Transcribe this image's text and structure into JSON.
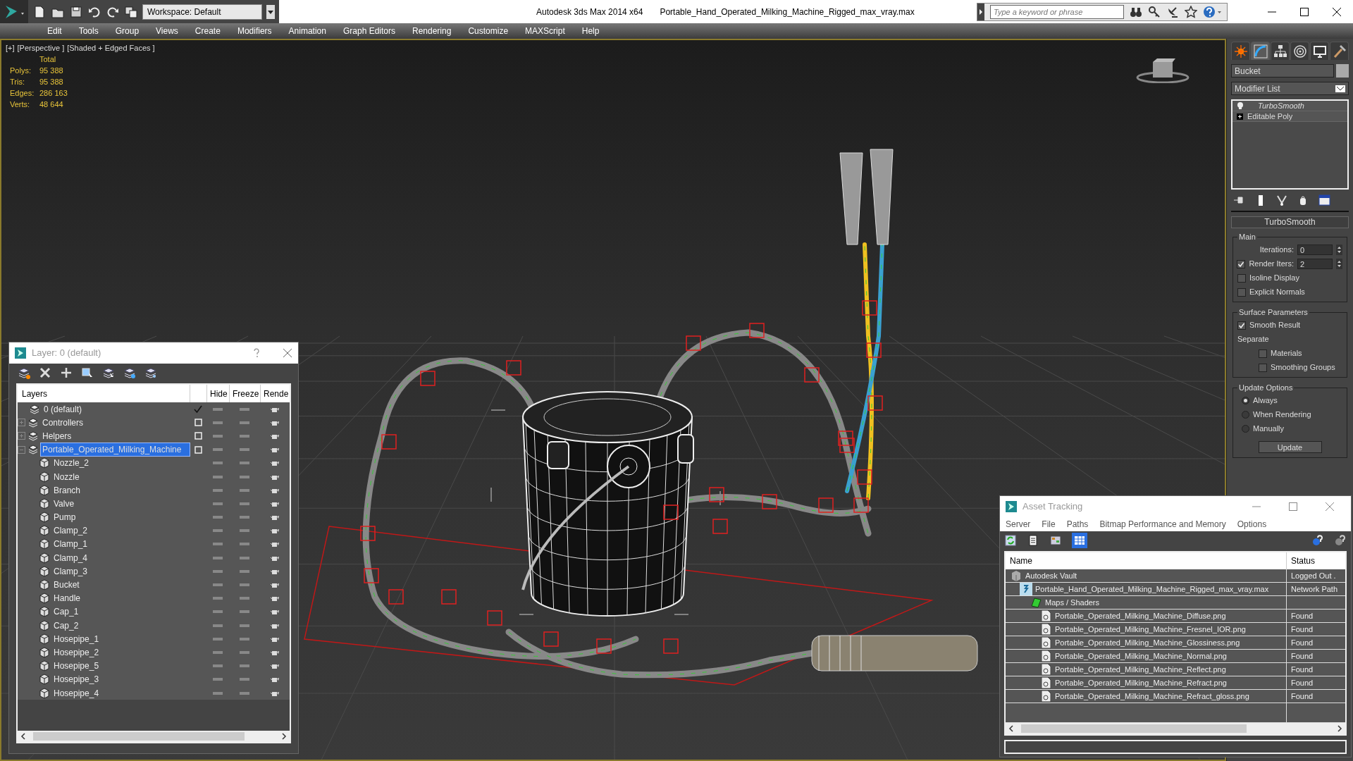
{
  "title_bar": {
    "workspace": "Workspace: Default",
    "app_title": "Autodesk 3ds Max  2014 x64",
    "file_title": "Portable_Hand_Operated_Milking_Machine_Rigged_max_vray.max",
    "search_placeholder": "Type a keyword or phrase"
  },
  "menu": [
    "Edit",
    "Tools",
    "Group",
    "Views",
    "Create",
    "Modifiers",
    "Animation",
    "Graph Editors",
    "Rendering",
    "Customize",
    "MAXScript",
    "Help"
  ],
  "viewport": {
    "labels": [
      "[+]",
      "[Perspective ]",
      "[Shaded + Edged Faces ]"
    ],
    "stats": {
      "header": "Total",
      "rows": [
        {
          "label": "Polys:",
          "value": "95 388"
        },
        {
          "label": "Tris:",
          "value": "95 388"
        },
        {
          "label": "Edges:",
          "value": "286 163"
        },
        {
          "label": "Verts:",
          "value": "48 644"
        }
      ]
    }
  },
  "layer_window": {
    "title": "Layer: 0 (default)",
    "columns": [
      "Layers",
      "Hide",
      "Freeze",
      "Rende"
    ],
    "layers": [
      {
        "name": "0 (default)",
        "current": true,
        "selected": false
      },
      {
        "name": "Controllers",
        "current": false,
        "selected": false,
        "expanded": false
      },
      {
        "name": "Helpers",
        "current": false,
        "selected": false,
        "expanded": false
      },
      {
        "name": "Portable_Operated_Milking_Machine",
        "current": false,
        "selected": true,
        "expanded": true,
        "children": [
          {
            "name": "Nozzle_2"
          },
          {
            "name": "Nozzle"
          },
          {
            "name": "Branch"
          },
          {
            "name": "Valve"
          },
          {
            "name": "Pump"
          },
          {
            "name": "Clamp_2"
          },
          {
            "name": "Clamp_1"
          },
          {
            "name": "Clamp_4"
          },
          {
            "name": "Clamp_3"
          },
          {
            "name": "Bucket"
          },
          {
            "name": "Handle"
          },
          {
            "name": "Cap_1"
          },
          {
            "name": "Cap_2"
          },
          {
            "name": "Hosepipe_1"
          },
          {
            "name": "Hosepipe_2"
          },
          {
            "name": "Hosepipe_5"
          },
          {
            "name": "Hosepipe_3"
          },
          {
            "name": "Hosepipe_4"
          }
        ]
      }
    ]
  },
  "command_panel": {
    "tabs": [
      {
        "kind": "create",
        "selected": false
      },
      {
        "kind": "modify",
        "selected": true
      },
      {
        "kind": "hierarchy",
        "selected": false
      },
      {
        "kind": "motion",
        "selected": false
      },
      {
        "kind": "display",
        "selected": false
      },
      {
        "kind": "utilities",
        "selected": false
      }
    ],
    "object_name": "Bucket",
    "modifier_list": "Modifier List",
    "stack": [
      {
        "kind": "modifier",
        "name": "TurboSmooth"
      },
      {
        "kind": "base",
        "name": "Editable Poly"
      }
    ],
    "rollout": {
      "title": "TurboSmooth",
      "groups": [
        {
          "title": "Main",
          "controls": [
            {
              "kind": "spinner",
              "label": "Iterations:",
              "value": "0"
            },
            {
              "kind": "check_spinner",
              "label": "Render Iters:",
              "value": "2",
              "checked": true
            },
            {
              "kind": "checkbox",
              "label": "Isoline Display",
              "checked": false
            },
            {
              "kind": "checkbox",
              "label": "Explicit Normals",
              "checked": false
            }
          ]
        },
        {
          "title": "Surface Parameters",
          "controls": [
            {
              "kind": "checkbox",
              "label": "Smooth Result",
              "checked": true
            },
            {
              "kind": "text",
              "label": "Separate"
            },
            {
              "kind": "sub_checkbox",
              "label": "Materials",
              "checked": false
            },
            {
              "kind": "sub_checkbox",
              "label": "Smoothing Groups",
              "checked": false
            }
          ]
        },
        {
          "title": "Update Options",
          "controls": [
            {
              "kind": "radio",
              "label": "Always",
              "selected": true
            },
            {
              "kind": "radio",
              "label": "When Rendering",
              "selected": false
            },
            {
              "kind": "radio",
              "label": "Manually",
              "selected": false
            },
            {
              "kind": "button",
              "label": "Update"
            }
          ]
        }
      ]
    }
  },
  "asset_window": {
    "title": "Asset Tracking",
    "menu": [
      "Server",
      "File",
      "Paths",
      "Bitmap Performance and Memory",
      "Options"
    ],
    "columns": [
      "Name",
      "Status"
    ],
    "rows": [
      {
        "kind": "vault",
        "name": "Autodesk Vault",
        "status": "Logged Out .",
        "children": [
          {
            "kind": "scene",
            "name": "Portable_Hand_Operated_Milking_Machine_Rigged_max_vray.max",
            "status": "Network Path",
            "children": [
              {
                "kind": "folder",
                "name": "Maps / Shaders",
                "children": [
                  {
                    "kind": "image",
                    "name": "Portable_Operated_Milking_Machine_Diffuse.png",
                    "status": "Found"
                  },
                  {
                    "kind": "image",
                    "name": "Portable_Operated_Milking_Machine_Fresnel_IOR.png",
                    "status": "Found"
                  },
                  {
                    "kind": "image",
                    "name": "Portable_Operated_Milking_Machine_Glossiness.png",
                    "status": "Found"
                  },
                  {
                    "kind": "image",
                    "name": "Portable_Operated_Milking_Machine_Normal.png",
                    "status": "Found"
                  },
                  {
                    "kind": "image",
                    "name": "Portable_Operated_Milking_Machine_Reflect.png",
                    "status": "Found"
                  },
                  {
                    "kind": "image",
                    "name": "Portable_Operated_Milking_Machine_Refract.png",
                    "status": "Found"
                  },
                  {
                    "kind": "image",
                    "name": "Portable_Operated_Milking_Machine_Refract_gloss.png",
                    "status": "Found"
                  }
                ]
              }
            ]
          }
        ]
      }
    ]
  }
}
